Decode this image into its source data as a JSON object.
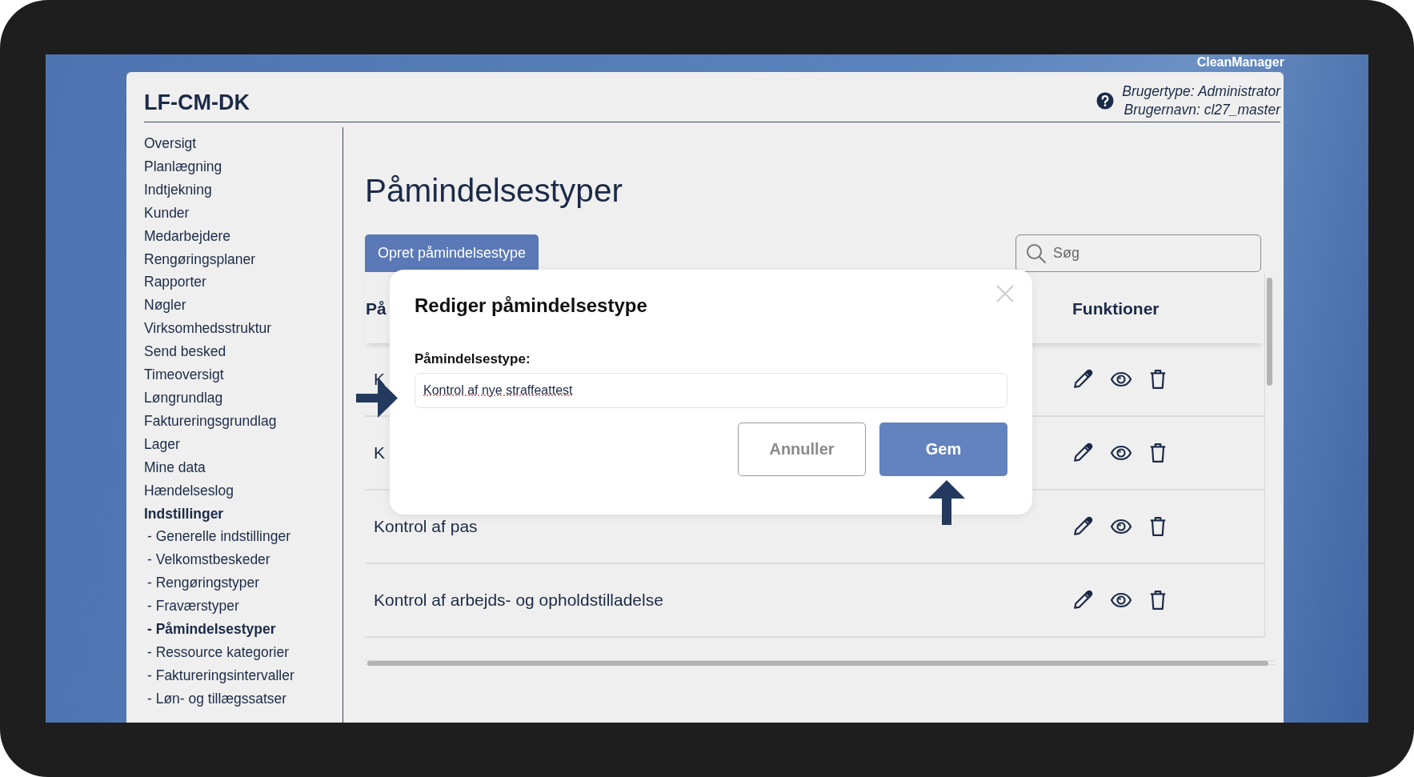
{
  "brand": "CleanManager",
  "app_title": "LF-CM-DK",
  "user": {
    "type_line": "Brugertype: Administrator",
    "name_line": "Brugernavn: cl27_master"
  },
  "sidebar": {
    "items": [
      {
        "label": "Oversigt",
        "selected": false,
        "expanded": false
      },
      {
        "label": "Planlægning",
        "selected": false,
        "expanded": false
      },
      {
        "label": "Indtjekning",
        "selected": false,
        "expanded": false
      },
      {
        "label": "Kunder",
        "selected": false,
        "expanded": false
      },
      {
        "label": "Medarbejdere",
        "selected": false,
        "expanded": false
      },
      {
        "label": "Rengøringsplaner",
        "selected": false,
        "expanded": false
      },
      {
        "label": "Rapporter",
        "selected": false,
        "expanded": false
      },
      {
        "label": "Nøgler",
        "selected": false,
        "expanded": false
      },
      {
        "label": "Virksomhedsstruktur",
        "selected": false,
        "expanded": false
      },
      {
        "label": "Send besked",
        "selected": false,
        "expanded": false
      },
      {
        "label": "Timeoversigt",
        "selected": false,
        "expanded": false
      },
      {
        "label": "Løngrundlag",
        "selected": false,
        "expanded": false
      },
      {
        "label": "Faktureringsgrundlag",
        "selected": false,
        "expanded": false
      },
      {
        "label": "Lager",
        "selected": false,
        "expanded": false
      },
      {
        "label": "Mine data",
        "selected": false,
        "expanded": false
      },
      {
        "label": "Hændelseslog",
        "selected": false,
        "expanded": false
      },
      {
        "label": "Indstillinger",
        "selected": false,
        "expanded": true,
        "children": [
          {
            "marker": "-",
            "label": "Generelle indstillinger",
            "selected": false
          },
          {
            "marker": "-",
            "label": "Velkomstbeskeder",
            "selected": false
          },
          {
            "marker": "-",
            "label": "Rengøringstyper",
            "selected": false
          },
          {
            "marker": "-",
            "label": "Fraværstyper",
            "selected": false
          },
          {
            "marker": "-",
            "label": "Påmindelsestyper",
            "selected": true
          },
          {
            "marker": "-",
            "label": "Ressource kategorier",
            "selected": false
          },
          {
            "marker": "-",
            "label": "Faktureringsintervaller",
            "selected": false
          },
          {
            "marker": "-",
            "label": "Løn- og tillægssatser",
            "selected": false
          }
        ]
      }
    ]
  },
  "page": {
    "title": "Påmindelsestyper",
    "create_button": "Opret påmindelsestype",
    "search": {
      "placeholder": "Søg"
    },
    "table": {
      "columns": [
        {
          "label": "På"
        },
        {
          "label": "Funktioner"
        }
      ],
      "rows": [
        {
          "name": "K"
        },
        {
          "name": "K"
        },
        {
          "name": "Kontrol af pas"
        },
        {
          "name": "Kontrol af arbejds- og opholdstilladelse"
        }
      ]
    }
  },
  "modal": {
    "title": "Rediger påmindelsestype",
    "field_label": "Påmindelsestype:",
    "field_value": "Kontrol af nye straffeattest",
    "buttons": [
      {
        "label": "Annuller",
        "kind": "secondary"
      },
      {
        "label": "Gem",
        "kind": "primary"
      }
    ]
  }
}
